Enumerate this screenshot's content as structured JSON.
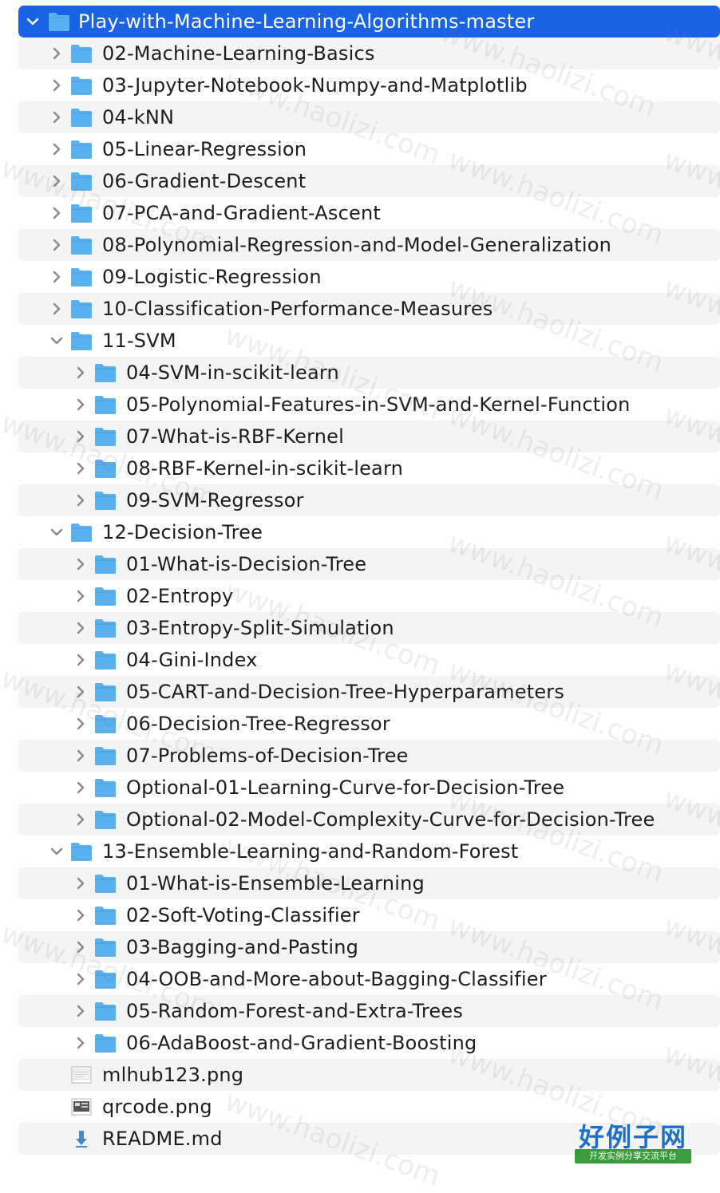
{
  "colors": {
    "selection": "#1b63e5",
    "folder": "#5ab1ee",
    "stripe": "#f4f4f5",
    "text": "#1d1d1f"
  },
  "tree": [
    {
      "label": "Play-with-Machine-Learning-Algorithms-master",
      "depth": 0,
      "kind": "folder",
      "expanded": true,
      "selected": true
    },
    {
      "label": "02-Machine-Learning-Basics",
      "depth": 1,
      "kind": "folder",
      "expanded": false
    },
    {
      "label": "03-Jupyter-Notebook-Numpy-and-Matplotlib",
      "depth": 1,
      "kind": "folder",
      "expanded": false
    },
    {
      "label": "04-kNN",
      "depth": 1,
      "kind": "folder",
      "expanded": false
    },
    {
      "label": "05-Linear-Regression",
      "depth": 1,
      "kind": "folder",
      "expanded": false
    },
    {
      "label": "06-Gradient-Descent",
      "depth": 1,
      "kind": "folder",
      "expanded": false
    },
    {
      "label": "07-PCA-and-Gradient-Ascent",
      "depth": 1,
      "kind": "folder",
      "expanded": false
    },
    {
      "label": "08-Polynomial-Regression-and-Model-Generalization",
      "depth": 1,
      "kind": "folder",
      "expanded": false
    },
    {
      "label": "09-Logistic-Regression",
      "depth": 1,
      "kind": "folder",
      "expanded": false
    },
    {
      "label": "10-Classification-Performance-Measures",
      "depth": 1,
      "kind": "folder",
      "expanded": false
    },
    {
      "label": "11-SVM",
      "depth": 1,
      "kind": "folder",
      "expanded": true
    },
    {
      "label": "04-SVM-in-scikit-learn",
      "depth": 2,
      "kind": "folder",
      "expanded": false
    },
    {
      "label": "05-Polynomial-Features-in-SVM-and-Kernel-Function",
      "depth": 2,
      "kind": "folder",
      "expanded": false
    },
    {
      "label": "07-What-is-RBF-Kernel",
      "depth": 2,
      "kind": "folder",
      "expanded": false
    },
    {
      "label": "08-RBF-Kernel-in-scikit-learn",
      "depth": 2,
      "kind": "folder",
      "expanded": false
    },
    {
      "label": "09-SVM-Regressor",
      "depth": 2,
      "kind": "folder",
      "expanded": false
    },
    {
      "label": "12-Decision-Tree",
      "depth": 1,
      "kind": "folder",
      "expanded": true
    },
    {
      "label": "01-What-is-Decision-Tree",
      "depth": 2,
      "kind": "folder",
      "expanded": false
    },
    {
      "label": "02-Entropy",
      "depth": 2,
      "kind": "folder",
      "expanded": false
    },
    {
      "label": "03-Entropy-Split-Simulation",
      "depth": 2,
      "kind": "folder",
      "expanded": false
    },
    {
      "label": "04-Gini-Index",
      "depth": 2,
      "kind": "folder",
      "expanded": false
    },
    {
      "label": "05-CART-and-Decision-Tree-Hyperparameters",
      "depth": 2,
      "kind": "folder",
      "expanded": false
    },
    {
      "label": "06-Decision-Tree-Regressor",
      "depth": 2,
      "kind": "folder",
      "expanded": false
    },
    {
      "label": "07-Problems-of-Decision-Tree",
      "depth": 2,
      "kind": "folder",
      "expanded": false
    },
    {
      "label": "Optional-01-Learning-Curve-for-Decision-Tree",
      "depth": 2,
      "kind": "folder",
      "expanded": false
    },
    {
      "label": "Optional-02-Model-Complexity-Curve-for-Decision-Tree",
      "depth": 2,
      "kind": "folder",
      "expanded": false
    },
    {
      "label": "13-Ensemble-Learning-and-Random-Forest",
      "depth": 1,
      "kind": "folder",
      "expanded": true
    },
    {
      "label": "01-What-is-Ensemble-Learning",
      "depth": 2,
      "kind": "folder",
      "expanded": false
    },
    {
      "label": "02-Soft-Voting-Classifier",
      "depth": 2,
      "kind": "folder",
      "expanded": false
    },
    {
      "label": "03-Bagging-and-Pasting",
      "depth": 2,
      "kind": "folder",
      "expanded": false
    },
    {
      "label": "04-OOB-and-More-about-Bagging-Classifier",
      "depth": 2,
      "kind": "folder",
      "expanded": false
    },
    {
      "label": "05-Random-Forest-and-Extra-Trees",
      "depth": 2,
      "kind": "folder",
      "expanded": false
    },
    {
      "label": "06-AdaBoost-and-Gradient-Boosting",
      "depth": 2,
      "kind": "folder",
      "expanded": false
    },
    {
      "label": "mlhub123.png",
      "depth": 1,
      "kind": "image"
    },
    {
      "label": "qrcode.png",
      "depth": 1,
      "kind": "image-dark"
    },
    {
      "label": "README.md",
      "depth": 1,
      "kind": "markdown"
    }
  ],
  "watermark": {
    "text": "www.haolizi.com"
  },
  "logo": {
    "title": "好例子网",
    "subtitle": "开发实例分享交流平台"
  }
}
